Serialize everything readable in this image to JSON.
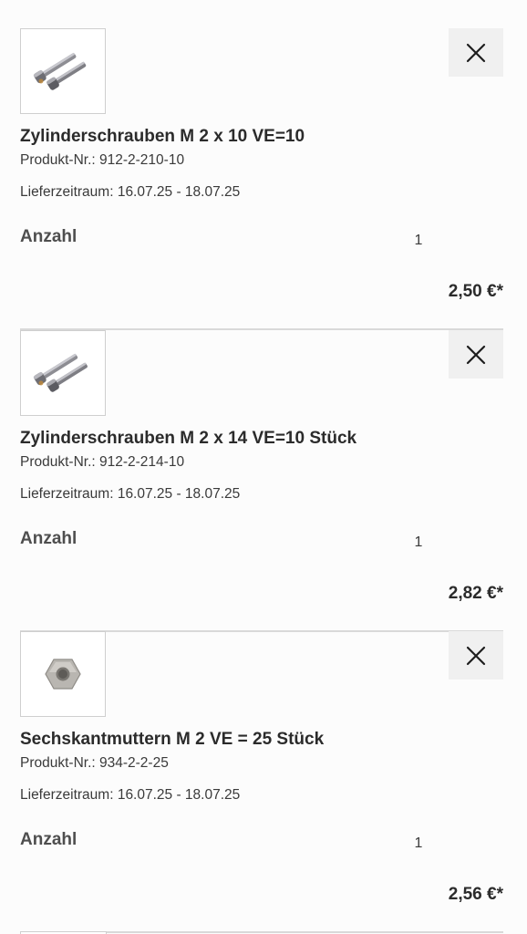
{
  "cart": {
    "items": [
      {
        "title": "Zylinderschrauben M 2 x 10 VE=10",
        "product_number": "Produkt-Nr.: 912-2-210-10",
        "delivery": "Lieferzeitraum: 16.07.25 - 18.07.25",
        "quantity_label": "Anzahl",
        "quantity": "1",
        "price": "2,50 €*",
        "image_icon": "screw-icon"
      },
      {
        "title": "Zylinderschrauben M 2 x 14 VE=10 Stück",
        "product_number": "Produkt-Nr.: 912-2-214-10",
        "delivery": "Lieferzeitraum: 16.07.25 - 18.07.25",
        "quantity_label": "Anzahl",
        "quantity": "1",
        "price": "2,82 €*",
        "image_icon": "screw-icon"
      },
      {
        "title": "Sechskantmuttern M 2 VE = 25 Stück",
        "product_number": "Produkt-Nr.: 934-2-2-25",
        "delivery": "Lieferzeitraum: 16.07.25 - 18.07.25",
        "quantity_label": "Anzahl",
        "quantity": "1",
        "price": "2,56 €*",
        "image_icon": "hex-nut-icon"
      }
    ],
    "remove_icon": "close-icon"
  }
}
